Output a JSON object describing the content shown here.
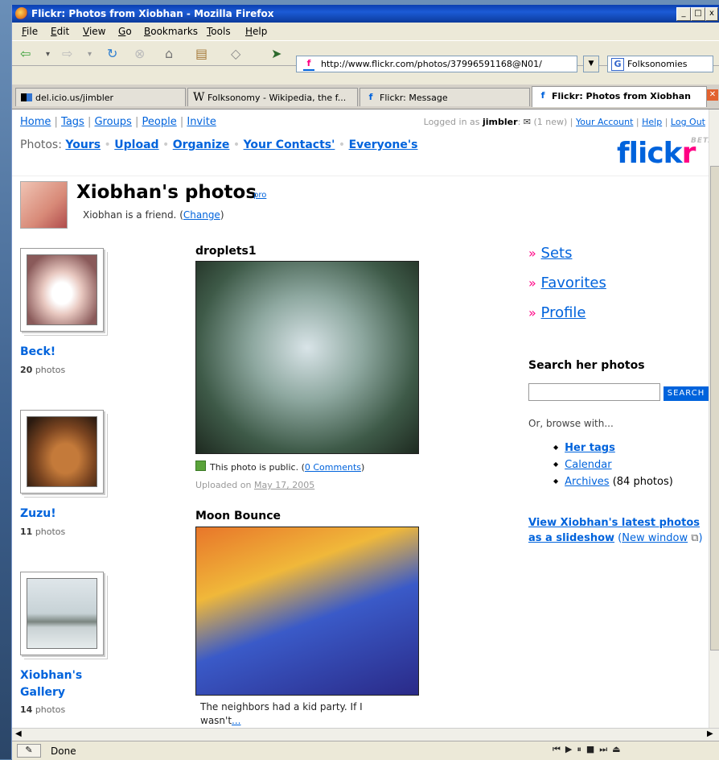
{
  "window": {
    "title": "Flickr: Photos from Xiobhan - Mozilla Firefox"
  },
  "menu": [
    "File",
    "Edit",
    "View",
    "Go",
    "Bookmarks",
    "Tools",
    "Help"
  ],
  "url": "http://www.flickr.com/photos/37996591168@N01/",
  "search_engine": "Folksonomies",
  "tabs": [
    {
      "label": "del.icio.us/jimbler",
      "icon": "delicious-icon"
    },
    {
      "label": "Folksonomy - Wikipedia, the f...",
      "icon": "wikipedia-icon"
    },
    {
      "label": "Flickr: Message",
      "icon": "flickr-icon"
    },
    {
      "label": "Flickr: Photos from Xiobhan",
      "icon": "flickr-icon",
      "active": true
    }
  ],
  "topnav": [
    "Home",
    "Tags",
    "Groups",
    "People",
    "Invite"
  ],
  "account": {
    "logged_in_prefix": "Logged in as",
    "user": "jimbler",
    "messages": "(1 new)",
    "links": [
      "Your Account",
      "Help",
      "Log Out"
    ]
  },
  "photos_bar": {
    "label": "Photos:",
    "items": [
      "Yours",
      "Upload",
      "Organize",
      "Your Contacts'",
      "Everyone's"
    ]
  },
  "logo": {
    "text_main": "flick",
    "text_r": "r",
    "beta": "BETA"
  },
  "profile": {
    "title": "Xiobhan's photos",
    "pro": "pro",
    "friend_text": "Xiobhan is a friend. (",
    "change": "Change",
    "friend_end": ")"
  },
  "sets": [
    {
      "title": "Beck!",
      "count": "20",
      "unit": "photos"
    },
    {
      "title": "Zuzu!",
      "count": "11",
      "unit": "photos"
    },
    {
      "title": "Xiobhan's Gallery",
      "count": "14",
      "unit": "photos"
    }
  ],
  "photos": [
    {
      "title": "droplets1",
      "public_text": "This photo is public. (",
      "comments": "0 Comments",
      "uploaded_prefix": "Uploaded on",
      "uploaded_date": "May 17, 2005"
    },
    {
      "title": "Moon Bounce",
      "caption": "The neighbors had a kid party. If I wasn't",
      "more": "..."
    }
  ],
  "sidebar": {
    "links": [
      "Sets",
      "Favorites",
      "Profile"
    ],
    "search_heading": "Search her photos",
    "search_button": "SEARCH",
    "browse_text": "Or, browse with...",
    "browse": [
      {
        "label": "Her tags",
        "bold": true
      },
      {
        "label": "Calendar"
      },
      {
        "label": "Archives",
        "suffix": " (84 photos)"
      }
    ],
    "slideshow": "View Xiobhan's latest photos as a slideshow",
    "new_window": "New window"
  },
  "status": "Done",
  "colors": {
    "flickr_blue": "#0063dc",
    "flickr_pink": "#ff0084",
    "xp_title": "#0a3fb0"
  }
}
